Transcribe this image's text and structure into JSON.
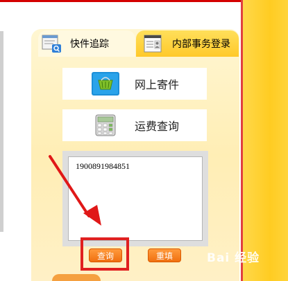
{
  "tabs": {
    "express_tracking": "快件追踪",
    "internal_login": "内部事务登录"
  },
  "services": {
    "online_shipping": "网上寄件",
    "freight_query": "运费查询"
  },
  "tracking": {
    "value": "1900891984851"
  },
  "actions": {
    "query_label": "查询",
    "reset_label": "重填"
  },
  "watermark": {
    "text": "Bai 经验"
  },
  "icons": {
    "express_tracking": "document-search-icon",
    "internal_login": "document-person-icon",
    "online_shipping": "shopping-basket-icon",
    "freight_query": "calculator-icon"
  },
  "colors": {
    "accent_orange": "#f07010",
    "highlight_red": "#e02020",
    "panel_bg": "#fff1c4",
    "side_yellow": "#ffcc22"
  }
}
